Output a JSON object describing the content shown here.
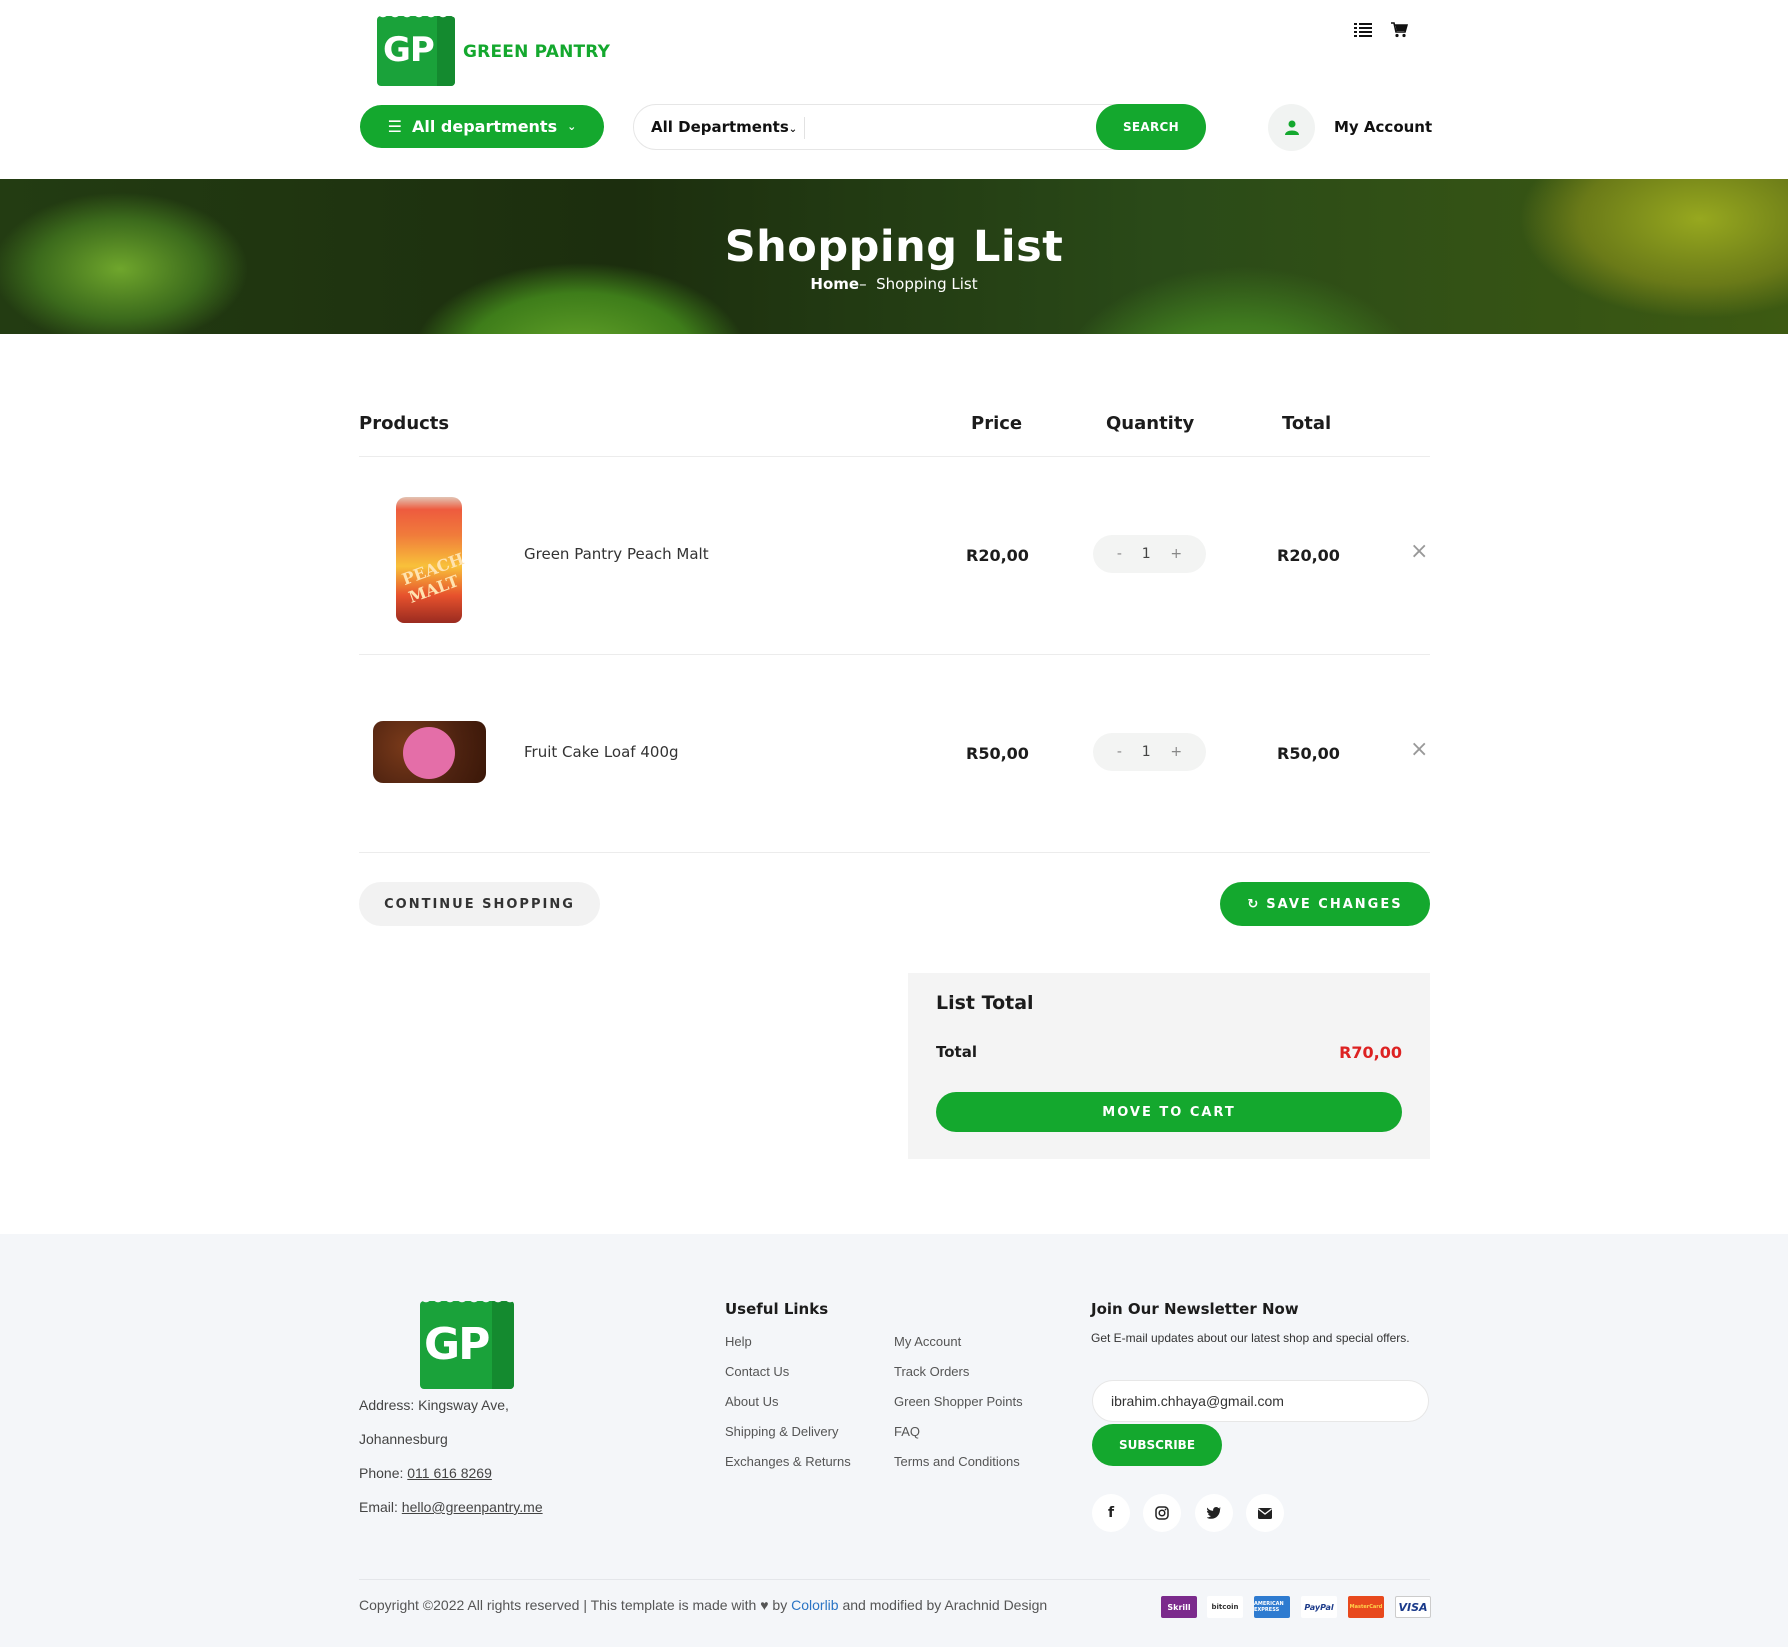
{
  "header": {
    "logo_text": "GP",
    "brand_name": "GREEN PANTRY",
    "departments_button": "All departments",
    "search": {
      "category": "All Departments",
      "placeholder": "",
      "button": "SEARCH"
    },
    "account_label": "My Account",
    "icons": [
      "list-icon",
      "cart-icon",
      "user-icon"
    ]
  },
  "hero": {
    "title": "Shopping List",
    "breadcrumb_home": "Home",
    "breadcrumb_sep": "–",
    "breadcrumb_current": "Shopping List"
  },
  "table": {
    "headers": {
      "products": "Products",
      "price": "Price",
      "quantity": "Quantity",
      "total": "Total"
    },
    "rows": [
      {
        "name": "Green Pantry Peach Malt",
        "price": "R20,00",
        "quantity": "1",
        "total": "R20,00",
        "image_label": "PEACH MALT"
      },
      {
        "name": "Fruit Cake Loaf 400g",
        "price": "R50,00",
        "quantity": "1",
        "total": "R50,00",
        "image_label": "Fruit Cake Loaf"
      }
    ],
    "qty_minus": "-",
    "qty_plus": "+",
    "remove_symbol": "×"
  },
  "actions": {
    "continue": "CONTINUE SHOPPING",
    "save": "SAVE CHANGES"
  },
  "summary": {
    "title": "List Total",
    "total_label": "Total",
    "total_value": "R70,00",
    "move_button": "MOVE TO CART"
  },
  "footer": {
    "logo_text": "GP",
    "address_line1": "Address: Kingsway Ave,",
    "address_line2": "Johannesburg",
    "phone_label": "Phone: ",
    "phone": "011 616 8269",
    "email_label": "Email: ",
    "email": "hello@greenpantry.me",
    "useful_links_title": "Useful Links",
    "links_col1": [
      "Help",
      "Contact Us",
      "About Us",
      "Shipping & Delivery",
      "Exchanges & Returns"
    ],
    "links_col2": [
      "My Account",
      "Track Orders",
      "Green Shopper Points",
      "FAQ",
      "Terms and Conditions"
    ],
    "newsletter_title": "Join Our Newsletter Now",
    "newsletter_sub": "Get E-mail updates about our latest shop and special offers.",
    "newsletter_email": "ibrahim.chhaya@gmail.com",
    "subscribe": "SUBSCRIBE",
    "social": [
      "facebook-icon",
      "instagram-icon",
      "twitter-icon",
      "envelope-icon"
    ],
    "copyright_pre": "Copyright ©2022 All rights reserved | This template is made with ",
    "copyright_by": " by ",
    "colorlib": "Colorlib",
    "copyright_post": " and modified by Arachnid Design",
    "payments": [
      "Skrill",
      "bitcoin",
      "AMERICAN EXPRESS",
      "PayPal",
      "MasterCard",
      "VISA"
    ]
  },
  "colors": {
    "accent": "#14a82e",
    "price_total": "#dd2222"
  }
}
